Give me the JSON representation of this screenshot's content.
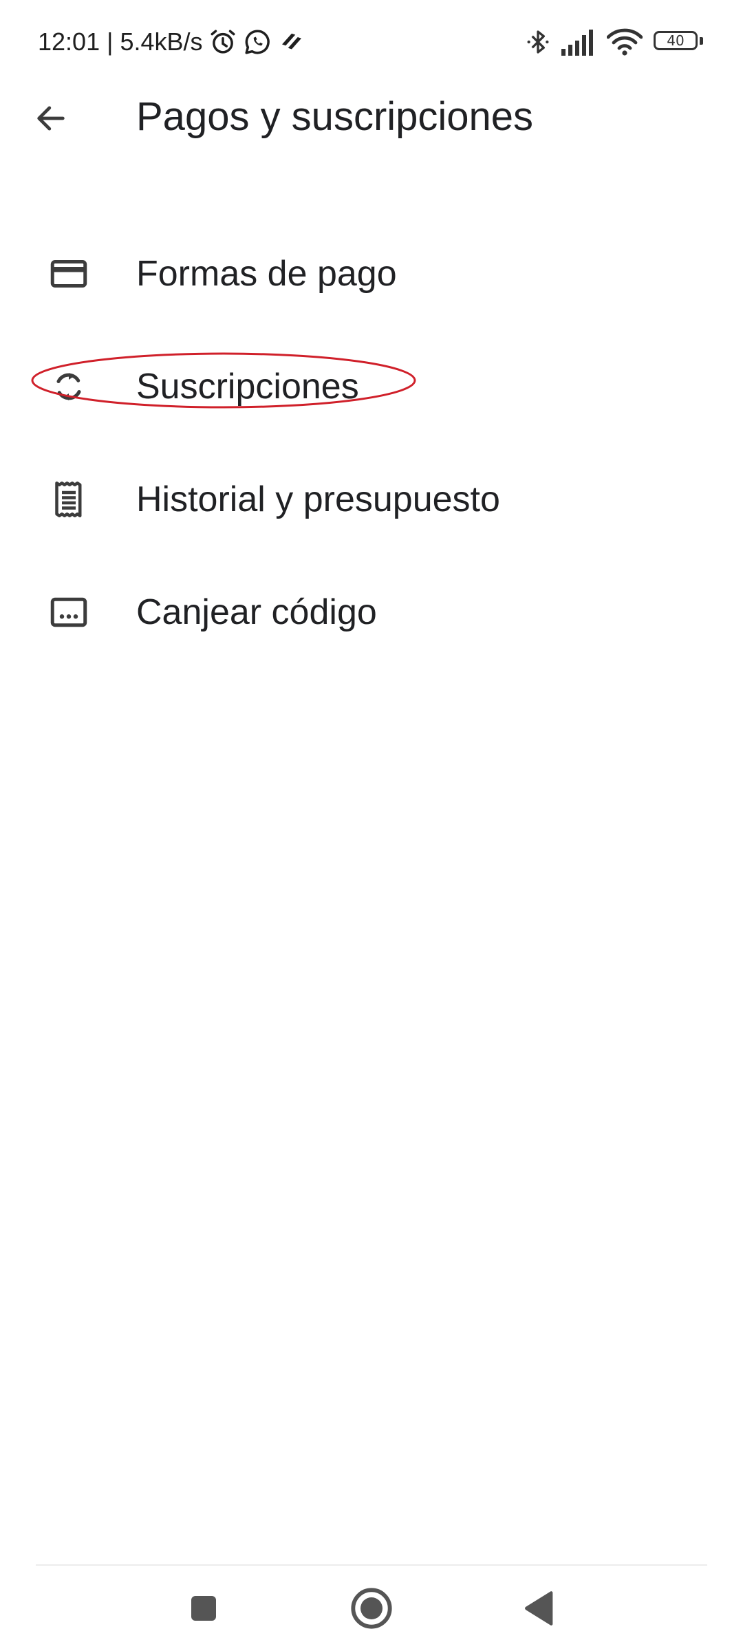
{
  "status_bar": {
    "time_and_speed": "12:01 | 5.4kB/s",
    "battery_level": "40",
    "icons_left": [
      "alarm-icon",
      "whatsapp-icon",
      "app-notification-icon"
    ],
    "icons_right": [
      "bluetooth-icon",
      "signal-icon",
      "wifi-icon",
      "battery-icon"
    ]
  },
  "app_bar": {
    "title": "Pagos y suscripciones",
    "back_icon": "arrow-back-icon"
  },
  "menu": {
    "items": [
      {
        "label": "Formas de pago",
        "icon": "credit-card-icon"
      },
      {
        "label": "Suscripciones",
        "icon": "autorenew-icon"
      },
      {
        "label": "Historial y presupuesto",
        "icon": "receipt-icon"
      },
      {
        "label": "Canjear código",
        "icon": "redeem-code-icon"
      }
    ]
  },
  "annotation": {
    "highlight_color": "#d0202a",
    "highlighted_item": "Suscripciones"
  },
  "nav_bar": {
    "buttons": [
      "recents-button",
      "home-button",
      "back-button"
    ]
  },
  "colors": {
    "text_primary": "#202124",
    "icon": "#3c3c3c",
    "background": "#ffffff"
  }
}
